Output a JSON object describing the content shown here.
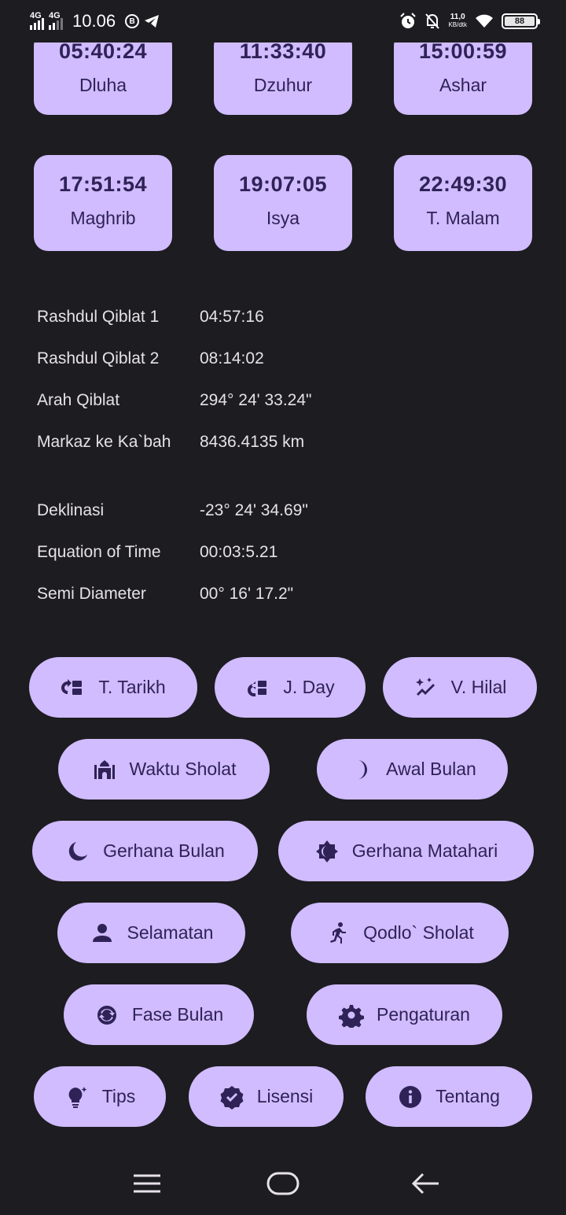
{
  "status_bar": {
    "sim1": "4G",
    "sim2": "4G",
    "time": "10.06",
    "net_speed": "11,0",
    "net_unit": "KB/dtk",
    "battery": "88"
  },
  "prayer_times": [
    {
      "time": "05:40:24",
      "name": "Dluha"
    },
    {
      "time": "11:33:40",
      "name": "Dzuhur"
    },
    {
      "time": "15:00:59",
      "name": "Ashar"
    },
    {
      "time": "17:51:54",
      "name": "Maghrib"
    },
    {
      "time": "19:07:05",
      "name": "Isya"
    },
    {
      "time": "22:49:30",
      "name": "T. Malam"
    }
  ],
  "qiblat_info": [
    {
      "label": "Rashdul Qiblat 1",
      "value": "04:57:16"
    },
    {
      "label": "Rashdul Qiblat 2",
      "value": "08:14:02"
    },
    {
      "label": "Arah Qiblat",
      "value": "294° 24' 33.24\""
    },
    {
      "label": "Markaz ke Ka`bah",
      "value": "8436.4135 km"
    }
  ],
  "sun_info": [
    {
      "label": "Deklinasi",
      "value": "-23° 24' 34.69\""
    },
    {
      "label": "Equation of Time",
      "value": "00:03:5.21"
    },
    {
      "label": "Semi Diameter",
      "value": "00° 16' 17.2\""
    }
  ],
  "buttons": [
    {
      "label": "T. Tarikh",
      "icon": "convert-date-icon"
    },
    {
      "label": "J. Day",
      "icon": "julian-day-icon"
    },
    {
      "label": "V. Hilal",
      "icon": "sparkle-chart-icon"
    },
    {
      "label": "Waktu Sholat",
      "icon": "mosque-icon"
    },
    {
      "label": "Awal Bulan",
      "icon": "crescent-moon-icon"
    },
    {
      "label": "Gerhana Bulan",
      "icon": "moon-eclipse-icon"
    },
    {
      "label": "Gerhana Matahari",
      "icon": "sun-eclipse-icon"
    },
    {
      "label": "Selamatan",
      "icon": "person-icon"
    },
    {
      "label": "Qodlo` Sholat",
      "icon": "running-person-icon"
    },
    {
      "label": "Fase Bulan",
      "icon": "moon-phase-icon"
    },
    {
      "label": "Pengaturan",
      "icon": "gear-icon"
    },
    {
      "label": "Tips",
      "icon": "lightbulb-icon"
    },
    {
      "label": "Lisensi",
      "icon": "verified-badge-icon"
    },
    {
      "label": "Tentang",
      "icon": "info-icon"
    }
  ],
  "colors": {
    "background": "#1d1c20",
    "card": "#d0bcff",
    "card_text": "#2f2257",
    "text": "#e6e1e9"
  }
}
